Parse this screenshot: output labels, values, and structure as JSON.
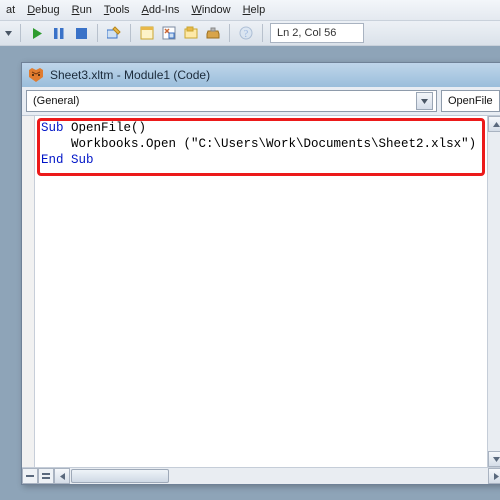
{
  "menu": {
    "items": [
      {
        "pre": "",
        "u": "",
        "post": "at"
      },
      {
        "pre": "",
        "u": "D",
        "post": "ebug"
      },
      {
        "pre": "",
        "u": "R",
        "post": "un"
      },
      {
        "pre": "",
        "u": "T",
        "post": "ools"
      },
      {
        "pre": "",
        "u": "A",
        "post": "dd-Ins"
      },
      {
        "pre": "",
        "u": "W",
        "post": "indow"
      },
      {
        "pre": "",
        "u": "H",
        "post": "elp"
      }
    ]
  },
  "toolbar": {
    "status": "Ln 2, Col 56"
  },
  "codeWindow": {
    "title": "Sheet3.xltm - Module1 (Code)",
    "leftCombo": "(General)",
    "rightCombo": "OpenFile",
    "code": {
      "l1a": "Sub",
      "l1b": " OpenFile()",
      "l2": "    Workbooks.Open (\"C:\\Users\\Work\\Documents\\Sheet2.xlsx\")",
      "l3": "End Sub"
    }
  }
}
